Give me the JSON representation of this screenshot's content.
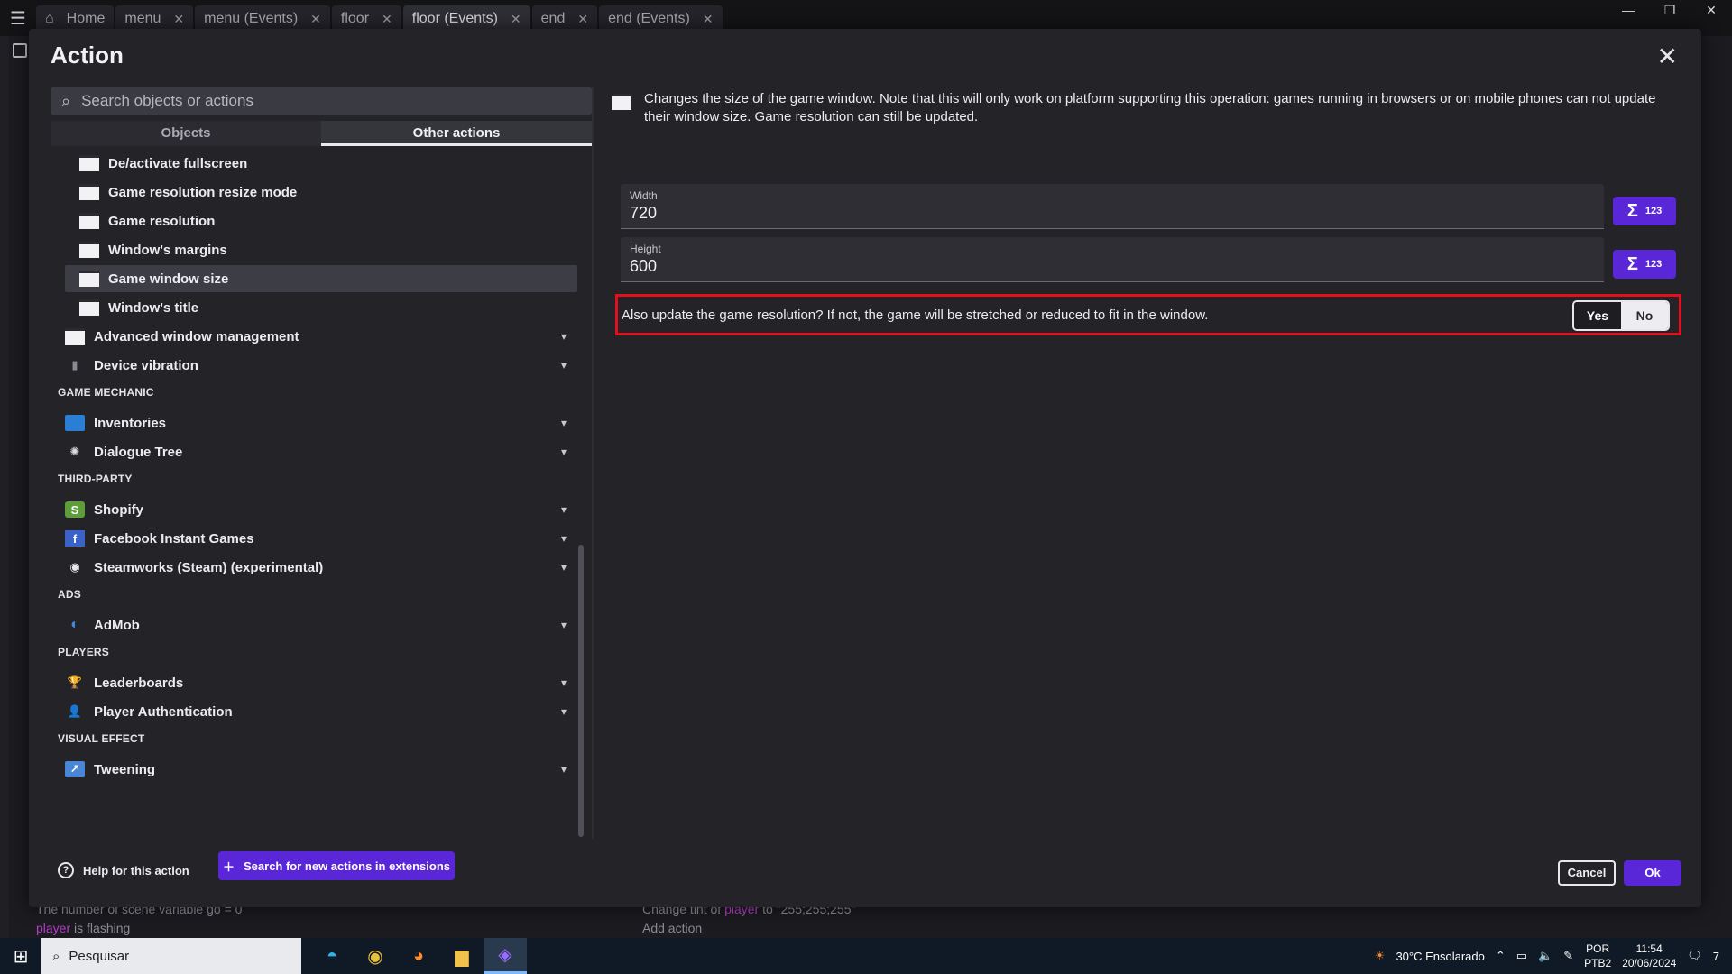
{
  "tabbar": {
    "tabs": [
      {
        "label": "Home",
        "closable": false
      },
      {
        "label": "menu",
        "closable": true
      },
      {
        "label": "menu (Events)",
        "closable": true
      },
      {
        "label": "floor",
        "closable": true
      },
      {
        "label": "floor (Events)",
        "closable": true,
        "active": true
      },
      {
        "label": "end",
        "closable": true
      },
      {
        "label": "end (Events)",
        "closable": true
      }
    ]
  },
  "background": {
    "row1": "The number of scene variable",
    "row1b": "go",
    "row1c": "= 0",
    "row2_obj": "player",
    "row2_txt": "is flashing",
    "row3a": "Change tint of",
    "row3b": "player",
    "row3c": "to \"255;255;255\"",
    "add_action": "Add action"
  },
  "dialog": {
    "title": "Action",
    "search_placeholder": "Search objects or actions",
    "tab_objects": "Objects",
    "tab_other": "Other actions",
    "window_items": [
      "De/activate fullscreen",
      "Game resolution resize mode",
      "Game resolution",
      "Window's margins",
      "Game window size",
      "Window's title"
    ],
    "cat_advanced_window": "Advanced window management",
    "cat_device_vibration": "Device vibration",
    "sect_game_mechanic": "GAME MECHANIC",
    "cat_inventories": "Inventories",
    "cat_dialogue_tree": "Dialogue Tree",
    "sect_third_party": "THIRD-PARTY",
    "cat_shopify": "Shopify",
    "cat_facebook": "Facebook Instant Games",
    "cat_steamworks": "Steamworks (Steam) (experimental)",
    "sect_ads": "ADS",
    "cat_admob": "AdMob",
    "sect_players": "PLAYERS",
    "cat_leaderboards": "Leaderboards",
    "cat_player_auth": "Player Authentication",
    "sect_visual_effect": "VISUAL EFFECT",
    "cat_tweening": "Tweening",
    "ext_button": "Search for new actions in extensions",
    "description": "Changes the size of the game window. Note that this will only work on platform supporting this operation: games running in browsers or on mobile phones can not update their window size. Game resolution can still be updated.",
    "width_label": "Width",
    "width_value": "720",
    "height_label": "Height",
    "height_value": "600",
    "expr_sigma": "Σ",
    "expr_num": "123",
    "update_question": "Also update the game resolution? If not, the game will be stretched or reduced to fit in the window.",
    "yes": "Yes",
    "no": "No",
    "help": "Help for this action",
    "cancel": "Cancel",
    "ok": "Ok"
  },
  "taskbar": {
    "search": "Pesquisar",
    "weather": "30°C  Ensolarado",
    "lang1": "POR",
    "lang2": "PTB2",
    "time": "11:54",
    "date": "20/06/2024",
    "notif": "7"
  },
  "colors": {
    "accent": "#5a27d8",
    "highlight_border": "#e0101c",
    "dialog_bg": "#232328"
  }
}
